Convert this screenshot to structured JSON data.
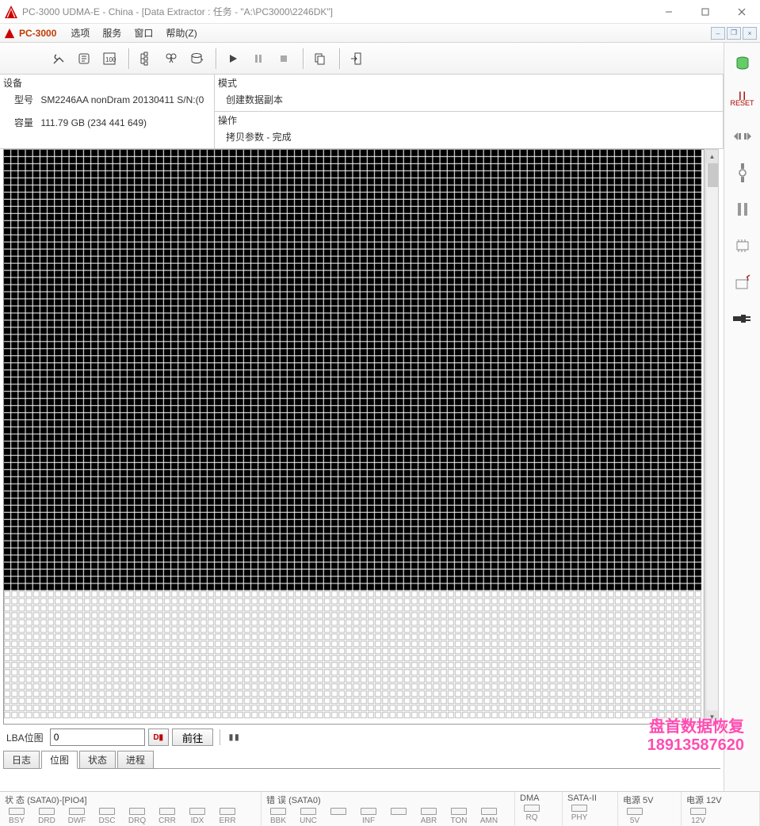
{
  "window": {
    "title": "PC-3000 UDMA-E - China - [Data Extractor : 任务 - \"A:\\PC3000\\2246DK\"]"
  },
  "menubar": {
    "product": "PC-3000",
    "items": [
      "选项",
      "服务",
      "窗口",
      "帮助(Z)"
    ]
  },
  "info": {
    "device_header": "设备",
    "model_label": "型号",
    "model_value": "SM2246AA nonDram 20130411 S/N:(0",
    "capacity_label": "容量",
    "capacity_value": "111.79 GB  (234 441 649)",
    "mode_header": "模式",
    "mode_value": "创建数据副本",
    "op_header": "操作",
    "op_value": "拷贝参数 - 完成"
  },
  "map": {
    "filled_fraction": 0.78
  },
  "nav": {
    "lba_label": "LBA位图",
    "lba_value": "0",
    "go_label": "前往"
  },
  "tabs": {
    "items": [
      "日志",
      "位图",
      "状态",
      "进程"
    ],
    "active_index": 1
  },
  "status": {
    "state_header": "状 态 (SATA0)-[PIO4]",
    "state_leds": [
      "BSY",
      "DRD",
      "DWF",
      "DSC",
      "DRQ",
      "CRR",
      "IDX",
      "ERR"
    ],
    "error_header": "错 误 (SATA0)",
    "error_leds": [
      "BBK",
      "UNC",
      "",
      "INF",
      "",
      "ABR",
      "TON",
      "AMN"
    ],
    "dma_header": "DMA",
    "dma_leds": [
      "RQ"
    ],
    "sata2_header": "SATA-II",
    "sata2_leds": [
      "PHY"
    ],
    "p5_header": "电源 5V",
    "p5_leds": [
      "5V"
    ],
    "p12_header": "电源 12V",
    "p12_leds": [
      "12V"
    ]
  },
  "watermark": {
    "line1": "盘首数据恢复",
    "line2": "18913587620"
  }
}
